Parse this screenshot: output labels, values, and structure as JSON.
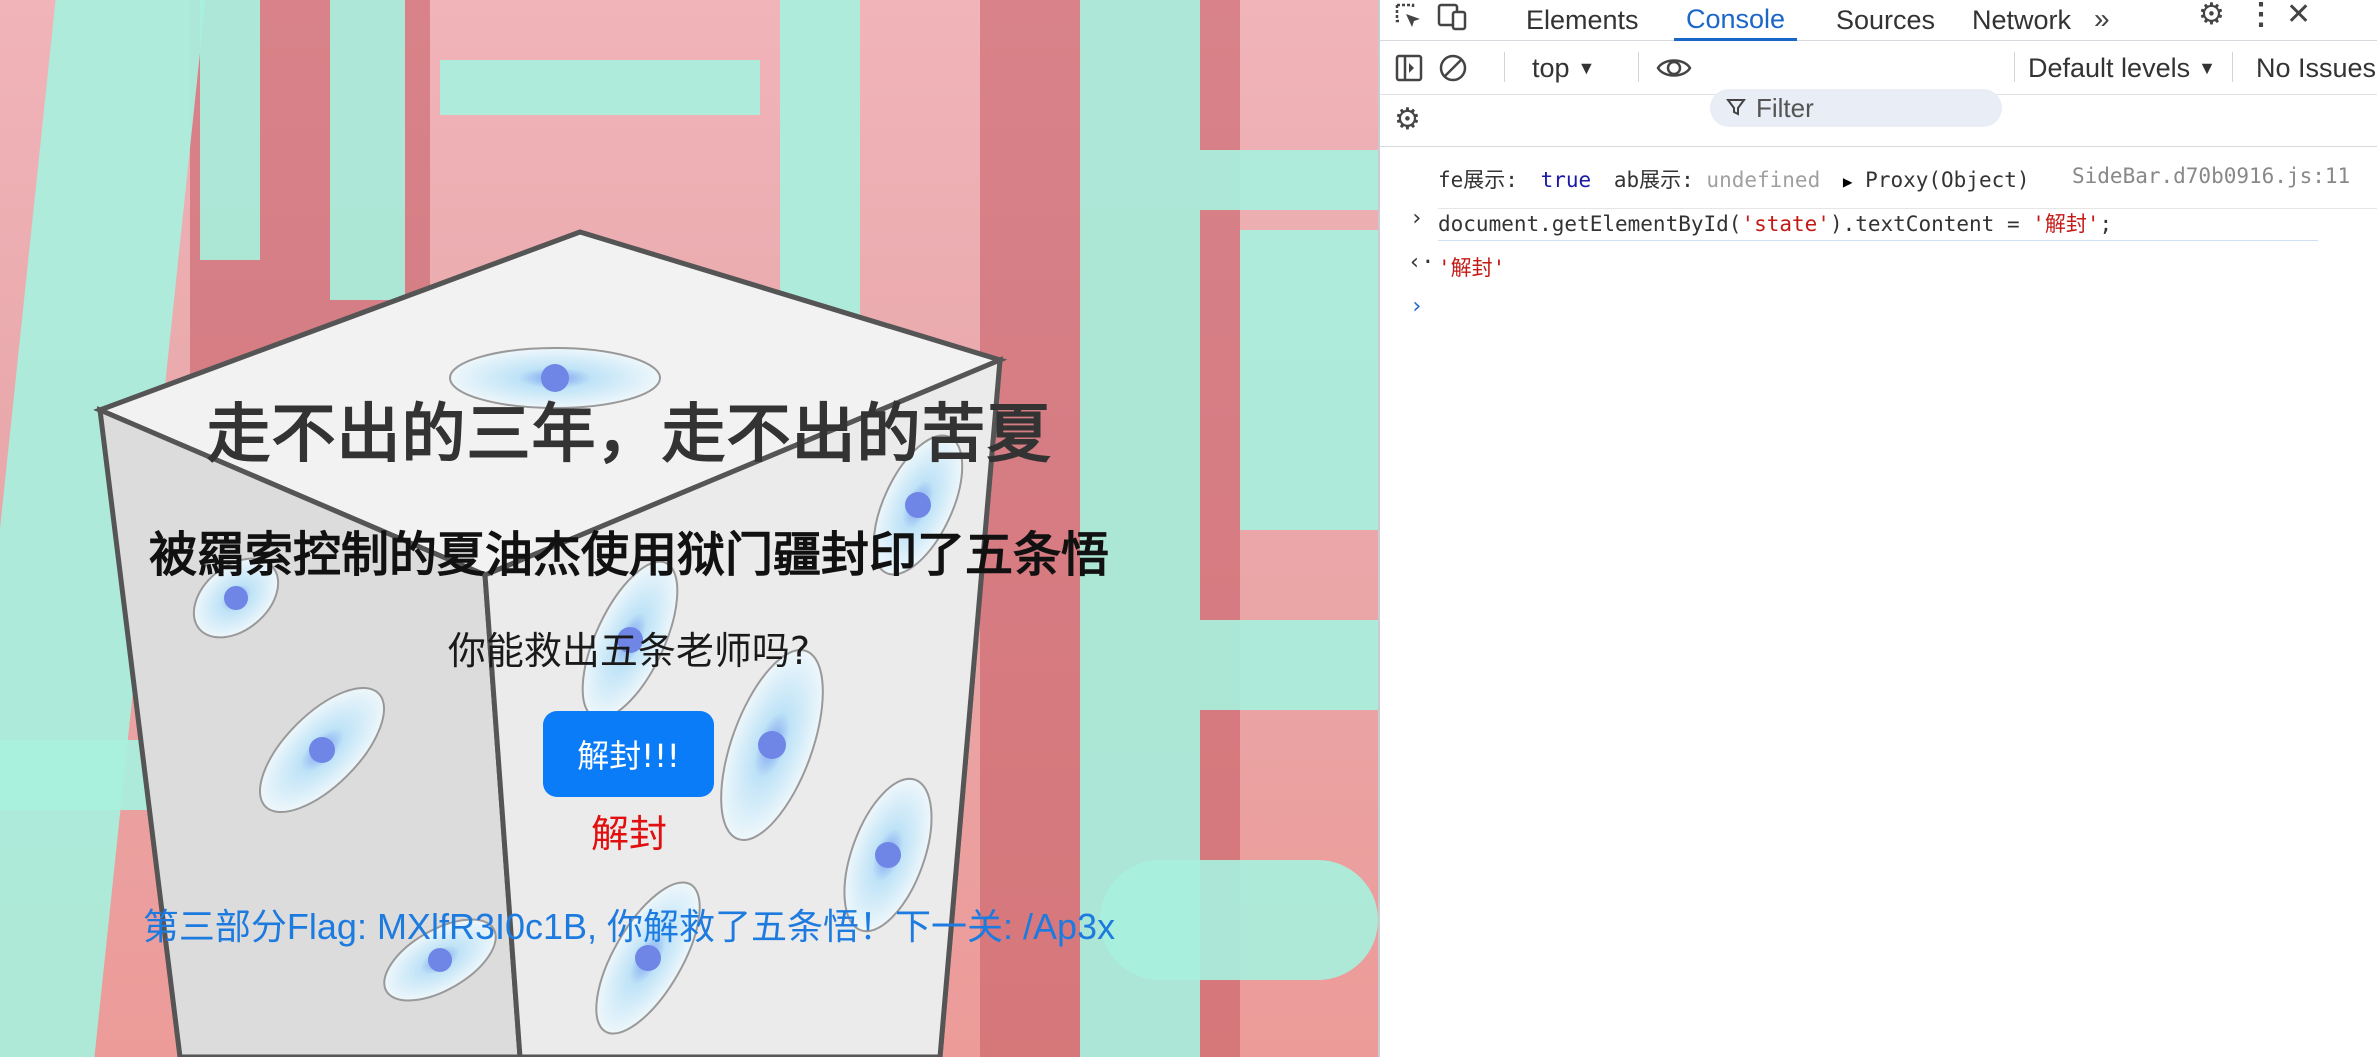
{
  "page": {
    "title": "走不出的三年，走不出的苦夏",
    "subtitle": "被羂索控制的夏油杰使用狱门疆封印了五条悟",
    "question": "你能救出五条老师吗?",
    "button_label": "解封!!!",
    "state": "解封",
    "flag_text": "第三部分Flag: MXlfR3I0c1B, 你解救了五条悟！下一关: /Ap3x"
  },
  "devtools": {
    "tabs": [
      "Elements",
      "Console",
      "Sources",
      "Network"
    ],
    "active_tab": "Console",
    "context": "top",
    "filter_placeholder": "Filter",
    "levels": "Default levels",
    "issues": "No Issues",
    "log": {
      "fe_label": "fe展示:",
      "fe_value": "true",
      "ab_label": "ab展示:",
      "ab_value": "undefined",
      "proxy": "Proxy(Object)",
      "source": "SideBar.d70b0916.js:11"
    },
    "command_prefix": "document.getElementById(",
    "command_arg": "'state'",
    "command_mid": ").textContent = ",
    "command_value": "'解封'",
    "command_end": ";",
    "result": "'解封'"
  },
  "colors": {
    "accent": "#1a66c9",
    "button": "#0a7cf7",
    "state": "#e10f0f",
    "flag": "#1d7be0"
  }
}
